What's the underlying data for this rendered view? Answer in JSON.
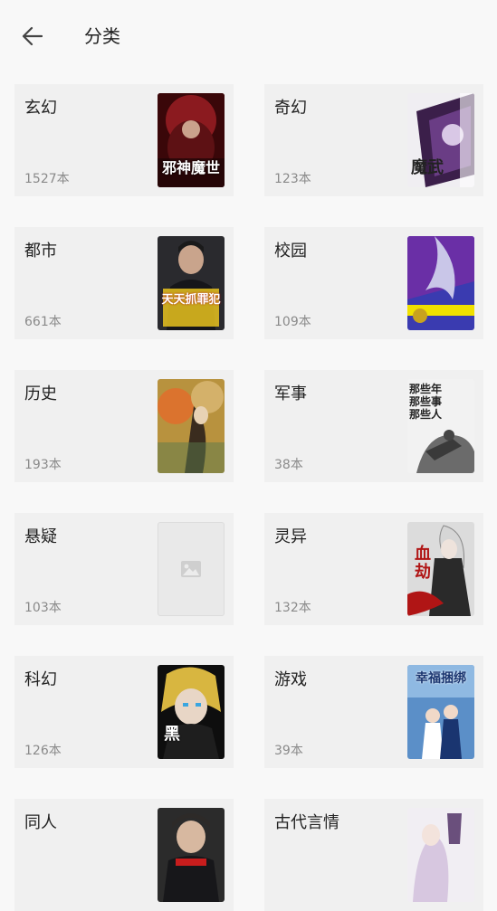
{
  "header": {
    "title": "分类",
    "back_icon": "arrow-left-icon"
  },
  "categories": [
    {
      "name": "玄幻",
      "count": "1527本",
      "cover": {
        "title": "邪神魔世",
        "bg": "#5a0f12",
        "accent": "#c8202a"
      }
    },
    {
      "name": "奇幻",
      "count": "123本",
      "cover": {
        "title": "魔武",
        "bg": "#f0eef2",
        "accent": "#3b1f4a"
      }
    },
    {
      "name": "都市",
      "count": "661本",
      "cover": {
        "title": "天天抓罪犯",
        "bg": "#2a2a2e",
        "accent": "#e8c21e"
      }
    },
    {
      "name": "校园",
      "count": "109本",
      "cover": {
        "title": "",
        "bg": "#3a3bb0",
        "accent": "#f0e000"
      }
    },
    {
      "name": "历史",
      "count": "193本",
      "cover": {
        "title": "",
        "bg": "#b8923e",
        "accent": "#e46b2a"
      }
    },
    {
      "name": "军事",
      "count": "38本",
      "cover": {
        "title": "那些年 那些事 那些人",
        "bg": "#f2f2f2",
        "accent": "#333333"
      }
    },
    {
      "name": "悬疑",
      "count": "103本",
      "cover": {
        "title": "",
        "bg": "#e9e9e9",
        "accent": "#cfcfcf",
        "placeholder": true
      }
    },
    {
      "name": "灵异",
      "count": "132本",
      "cover": {
        "title": "血劫",
        "bg": "#dcdcdc",
        "accent": "#b01515"
      }
    },
    {
      "name": "科幻",
      "count": "126本",
      "cover": {
        "title": "黑",
        "bg": "#0e0e0e",
        "accent": "#d8b640"
      }
    },
    {
      "name": "游戏",
      "count": "39本",
      "cover": {
        "title": "幸福捆绑",
        "bg": "#5b8fc8",
        "accent": "#1a3570"
      }
    },
    {
      "name": "同人",
      "count": "",
      "cover": {
        "title": "",
        "bg": "#2b2b2b",
        "accent": "#c81d1d"
      }
    },
    {
      "name": "古代言情",
      "count": "",
      "cover": {
        "title": "",
        "bg": "#f1eef3",
        "accent": "#6a4f7c"
      }
    }
  ]
}
